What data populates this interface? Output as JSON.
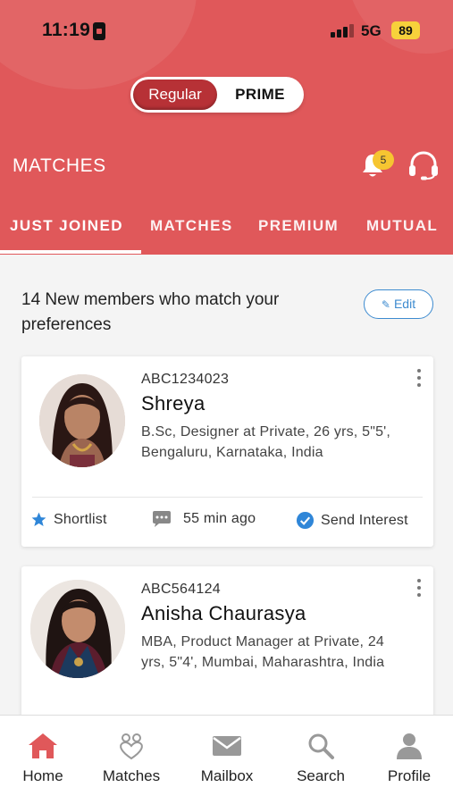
{
  "status_bar": {
    "time": "11:19",
    "network": "5G",
    "battery": "89"
  },
  "plan_toggle": {
    "regular": "Regular",
    "prime": "PRIME",
    "selected": "Regular"
  },
  "header": {
    "title": "MATCHES",
    "notification_count": "5"
  },
  "tabs": [
    {
      "label": "JUST JOINED",
      "active": true
    },
    {
      "label": "MATCHES",
      "active": false
    },
    {
      "label": "PREMIUM",
      "active": false
    },
    {
      "label": "MUTUAL",
      "active": false
    }
  ],
  "intro": {
    "text": "14 New members who match your preferences",
    "edit_label": "Edit"
  },
  "profiles": [
    {
      "id": "ABC1234023",
      "name": "Shreya",
      "details": "B.Sc, Designer at Private, 26 yrs, 5\"5', Bengaluru, Karnataka, India",
      "shortlist_label": "Shortlist",
      "last_seen": "55 min ago",
      "interest_label": "Send Interest"
    },
    {
      "id": "ABC564124",
      "name": "Anisha Chaurasya",
      "details": "MBA, Product Manager at Private, 24 yrs, 5\"4', Mumbai, Maharashtra, India"
    }
  ],
  "bottom_nav": [
    {
      "label": "Home",
      "icon": "home-icon",
      "active": true
    },
    {
      "label": "Matches",
      "icon": "matches-icon",
      "active": false
    },
    {
      "label": "Mailbox",
      "icon": "mailbox-icon",
      "active": false
    },
    {
      "label": "Search",
      "icon": "search-icon",
      "active": false
    },
    {
      "label": "Profile",
      "icon": "profile-icon",
      "active": false
    }
  ],
  "colors": {
    "brand": "#e0585a",
    "accent_dark": "#b73136",
    "link": "#3d8bd0",
    "badge": "#f6c531",
    "star": "#2f86d8"
  }
}
